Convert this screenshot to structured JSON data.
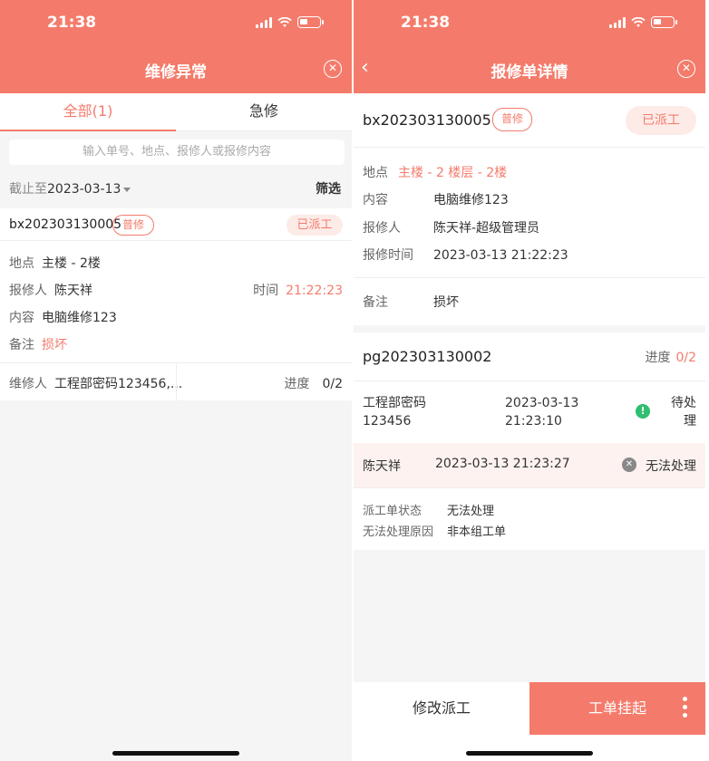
{
  "status_bar": {
    "time": "21:38"
  },
  "left": {
    "nav_title": "维修异常",
    "tabs": [
      {
        "label": "全部(1)"
      },
      {
        "label": "急修"
      }
    ],
    "search_placeholder": "输入单号、地点、报修人或报修内容",
    "filter": {
      "date_prefix": "截止至",
      "date": "2023-03-13",
      "filter_label": "筛选"
    },
    "card": {
      "order_no": "bx202303130005",
      "type_badge": "普修",
      "status_badge": "已派工",
      "location_label": "地点",
      "location": "主楼 - 2楼",
      "reporter_label": "报修人",
      "reporter": "陈天祥",
      "time_label": "时间",
      "time": "21:22:23",
      "content_label": "内容",
      "content": "电脑维修123",
      "remark_label": "备注",
      "remark": "损坏",
      "repairer_label": "维修人",
      "repairer": "工程部密码123456,...",
      "progress_label": "进度",
      "progress": "0/2"
    }
  },
  "right": {
    "nav_title": "报修单详情",
    "order_no": "bx202303130005",
    "type_badge": "普修",
    "status_badge": "已派工",
    "location_label": "地点",
    "location": "主楼 - 2 楼层 - 2楼",
    "content_label": "内容",
    "content": "电脑维修123",
    "reporter_label": "报修人",
    "reporter": "陈天祥-超级管理员",
    "report_time_label": "报修时间",
    "report_time": "2023-03-13 21:22:23",
    "remark_label": "备注",
    "remark": "损坏",
    "dispatch": {
      "order_no": "pg202303130002",
      "progress_label": "进度",
      "progress": "0/2",
      "assignee_line1": "工程部密码",
      "assignee_line2": "123456",
      "assign_date": "2023-03-13",
      "assign_time": "21:23:10",
      "assign_status_line1": "待处",
      "assign_status_line2": "理",
      "handler": "陈天祥",
      "handle_time": "2023-03-13 21:23:27",
      "handle_status": "无法处理",
      "state_label": "派工单状态",
      "state": "无法处理",
      "reason_label": "无法处理原因",
      "reason": "非本组工单"
    },
    "actions": {
      "modify": "修改派工",
      "hang_up": "工单挂起"
    }
  },
  "colors": {
    "accent": "#f47b6b",
    "success": "#2fbf71"
  },
  "icons": [
    "signal-icon",
    "wifi-icon",
    "battery-icon",
    "close-circle-icon",
    "back-chevron-icon",
    "caret-down-icon",
    "exclamation-circle-icon",
    "x-circle-icon",
    "more-dots-icon"
  ]
}
